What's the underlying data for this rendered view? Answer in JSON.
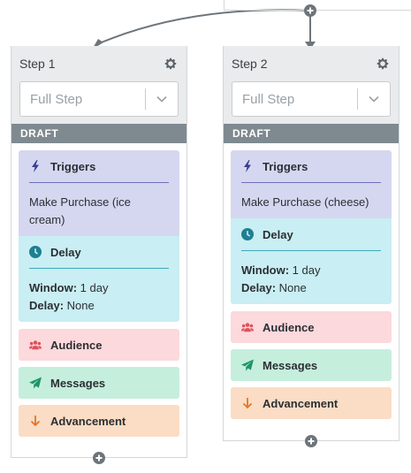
{
  "steps": [
    {
      "title": "Step 1",
      "step_type": "Full Step",
      "status": "DRAFT",
      "triggers": {
        "label": "Triggers",
        "body": "Make Purchase (ice cream)"
      },
      "delay": {
        "label": "Delay",
        "window_key": "Window:",
        "window_value": "1 day",
        "delay_key": "Delay:",
        "delay_value": "None"
      },
      "audience_label": "Audience",
      "messages_label": "Messages",
      "advancement_label": "Advancement"
    },
    {
      "title": "Step 2",
      "step_type": "Full Step",
      "status": "DRAFT",
      "triggers": {
        "label": "Triggers",
        "body": "Make Purchase (cheese)"
      },
      "delay": {
        "label": "Delay",
        "window_key": "Window:",
        "window_value": "1 day",
        "delay_key": "Delay:",
        "delay_value": "None"
      },
      "audience_label": "Audience",
      "messages_label": "Messages",
      "advancement_label": "Advancement"
    }
  ],
  "colors": {
    "triggers_bg": "#d5d7f0",
    "triggers_icon": "#3a3d8f",
    "delay_bg": "#c9eef3",
    "delay_icon": "#1f7f92",
    "audience_bg": "#fcd9dc",
    "audience_icon": "#e0505c",
    "messages_bg": "#c6eedd",
    "messages_icon": "#1f9466",
    "advancement_bg": "#fbdcc4",
    "advancement_icon": "#e0762a",
    "draft_bar": "#7f8a90",
    "connector": "#6d757b"
  },
  "icons": {
    "gear": "gear-icon",
    "chevron": "chevron-down-icon",
    "triggers": "lightning-bolt-icon",
    "delay": "clock-icon",
    "audience": "users-icon",
    "messages": "paper-plane-icon",
    "advancement": "arrow-down-icon",
    "add": "plus-circle-icon"
  }
}
